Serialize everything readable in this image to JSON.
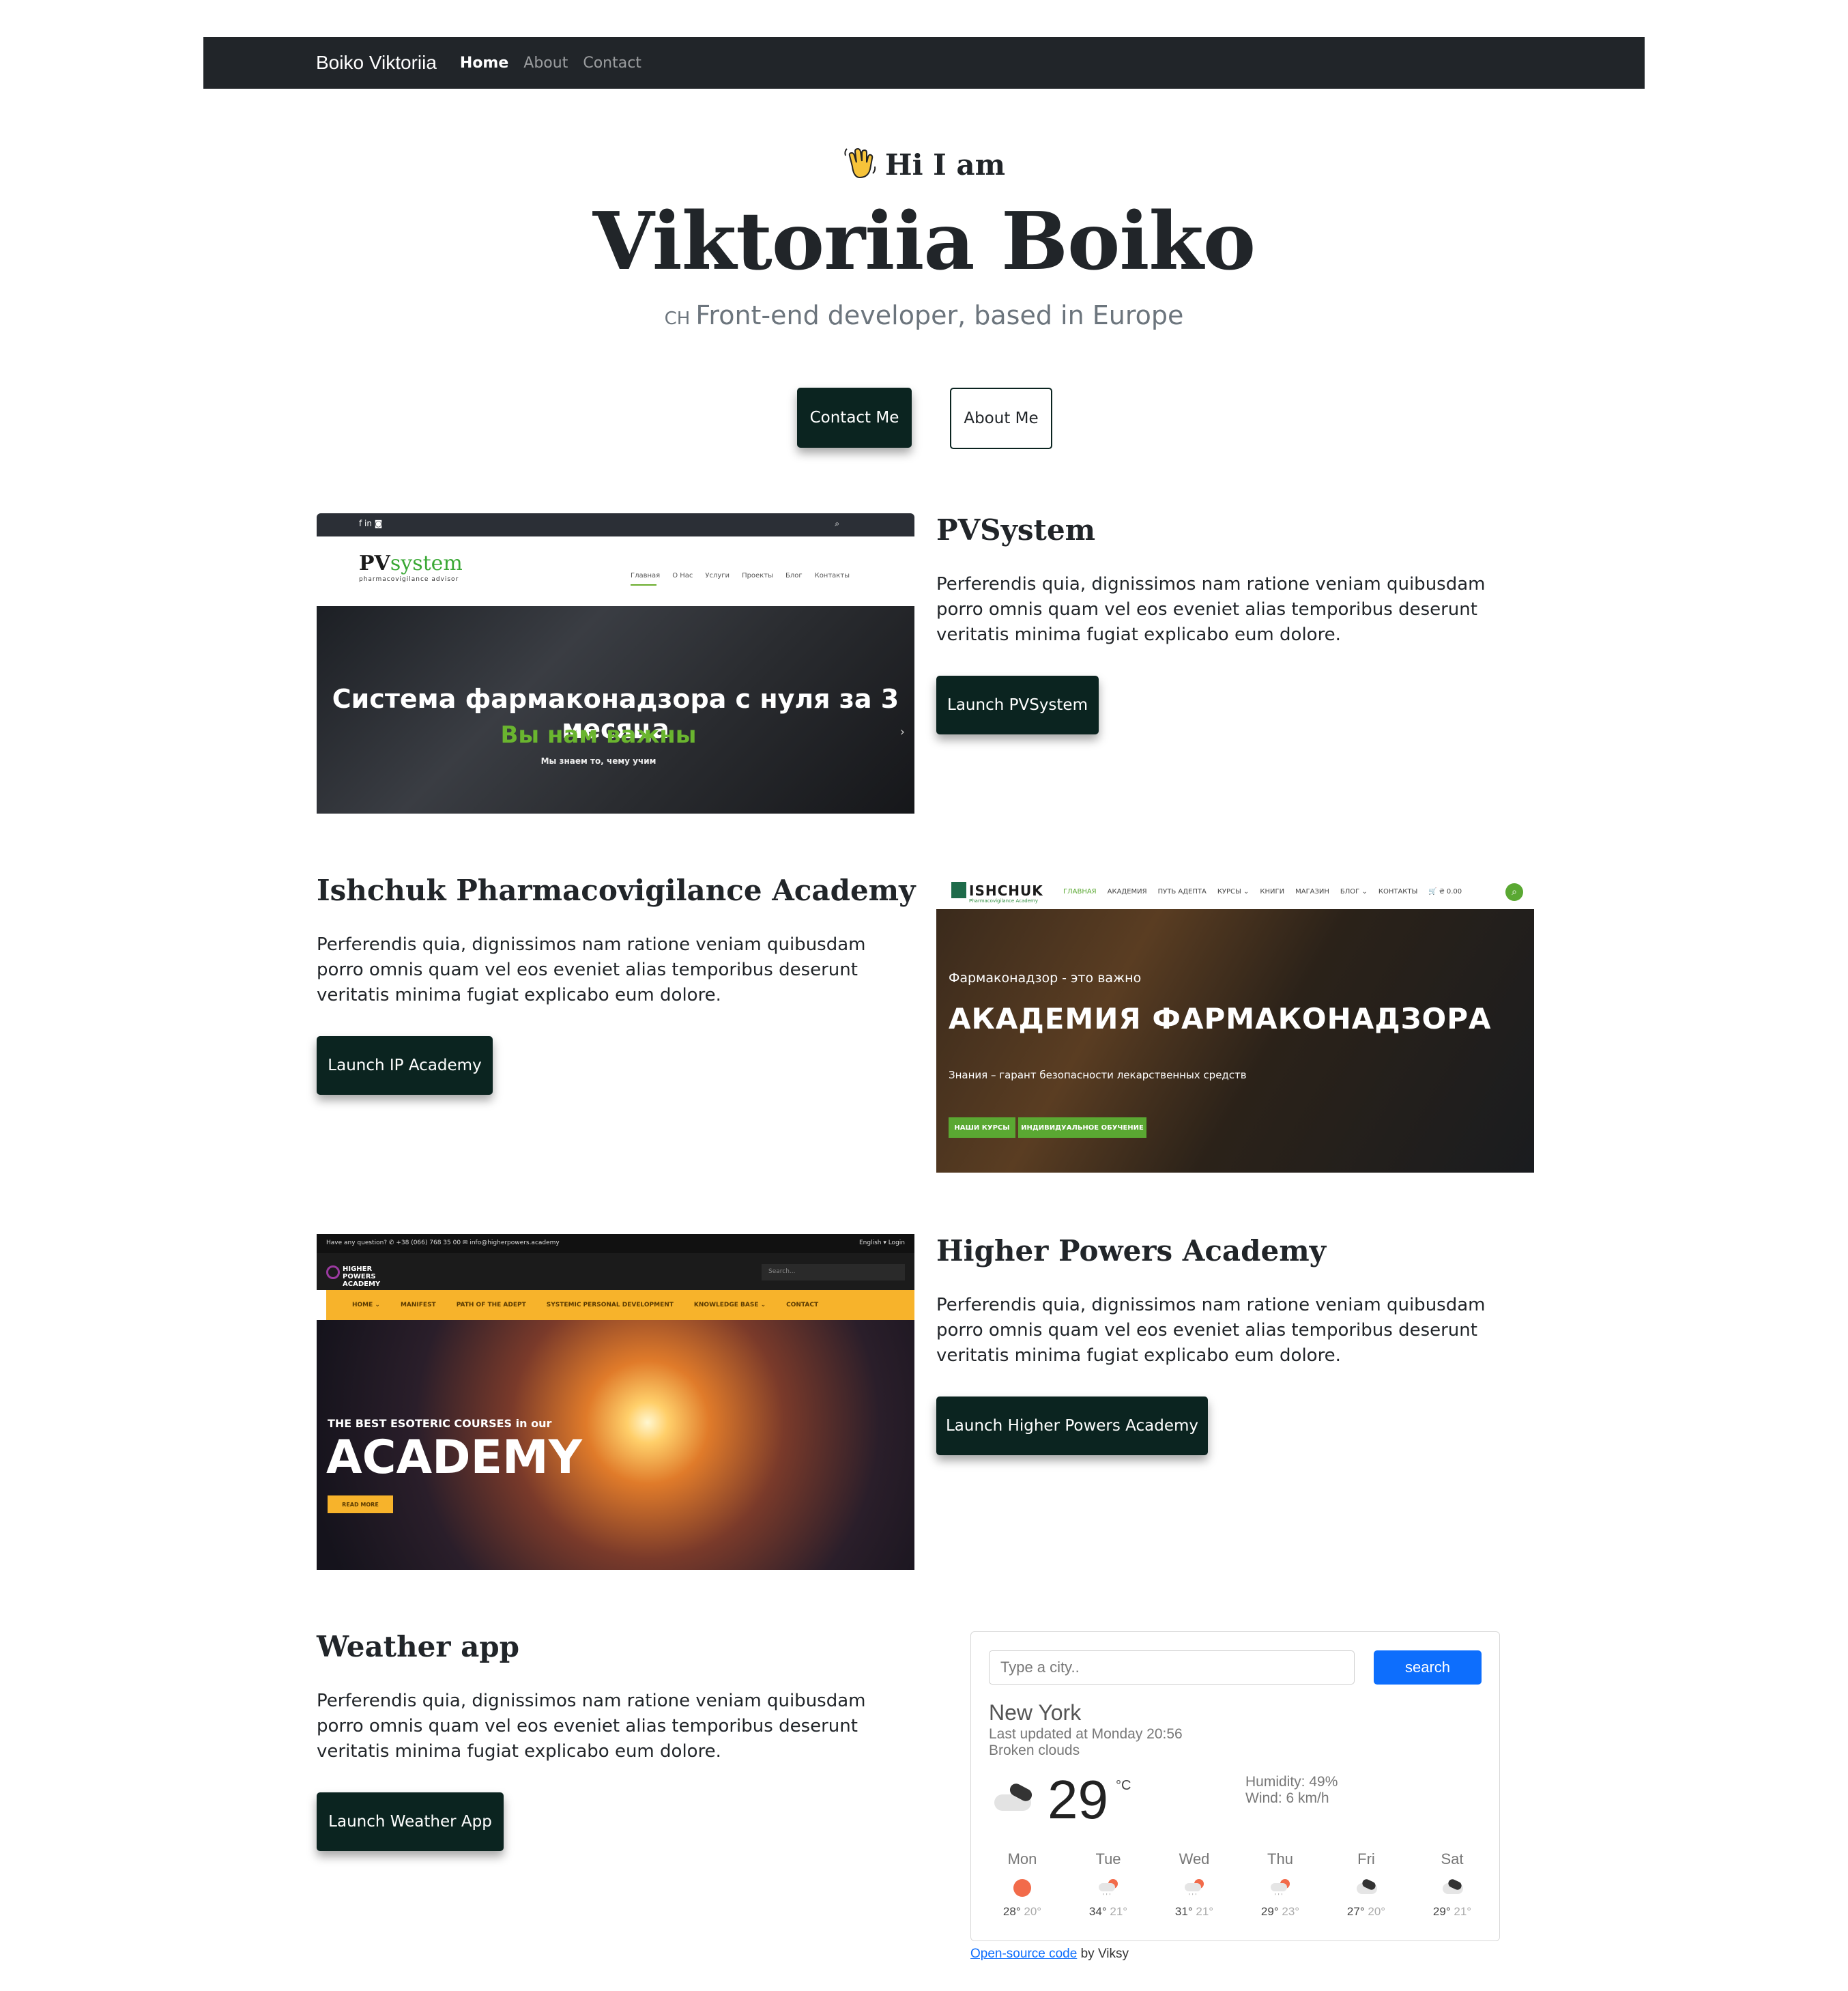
{
  "navbar": {
    "brand": "Boiko Viktoriia",
    "links": [
      "Home",
      "About",
      "Contact"
    ]
  },
  "hero": {
    "greeting": "Hi I am",
    "greeting_icon": "waving-hand-icon",
    "name": "Viktoriia Boiko",
    "subtitle_prefix": "CH",
    "subtitle": "Front-end developer, based in Europe",
    "contact_button": "Contact Me",
    "about_button": "About Me"
  },
  "projects": [
    {
      "title": "PVSystem",
      "description": "Perferendis quia, dignissimos nam ratione veniam quibusdam porro omnis quam vel eos eveniet alias temporibus deserunt veritatis minima fugiat explicabo eum dolore.",
      "button": "Launch PVSystem",
      "screenshot": {
        "logo_a": "PV",
        "logo_b": "system",
        "logo_sub": "pharmacovigilance advisor",
        "social": "f in ◙",
        "menu": [
          "Главная",
          "О Нас",
          "Услуги",
          "Проекты",
          "Блог",
          "Контакты"
        ],
        "headline": "Система фармаконадзора с нуля за 3 месяца",
        "green_line": "Вы нам важны",
        "small_line": "Мы знаем то, чему учим"
      }
    },
    {
      "title": "Ishchuk Pharmacovigilance Academy",
      "description": "Perferendis quia, dignissimos nam ratione veniam quibusdam porro omnis quam vel eos eveniet alias temporibus deserunt veritatis minima fugiat explicabo eum dolore.",
      "button": "Launch IP Academy",
      "screenshot": {
        "logo": "ISHCHUK",
        "logo_sub": "Pharmacovigilance Academy",
        "menu": [
          "ГЛАВНАЯ",
          "АКАДЕМИЯ",
          "ПУТЬ АДЕПТА",
          "КУРСЫ ⌄",
          "КНИГИ",
          "МАГАЗИН",
          "БЛОГ ⌄",
          "КОНТАКТЫ",
          "🛒 ₴ 0.00"
        ],
        "line1": "Фармаконадзор - это важно",
        "line2": "АКАДЕМИЯ ФАРМАКОНАДЗОРА",
        "line3": "Знания – гарант безопасности лекарственных средств",
        "btn1": "НАШИ КУРСЫ",
        "btn2": "ИНДИВИДУАЛЬНОЕ ОБУЧЕНИЕ"
      }
    },
    {
      "title": "Higher Powers Academy",
      "description": "Perferendis quia, dignissimos nam ratione veniam quibusdam porro omnis quam vel eos eveniet alias temporibus deserunt veritatis minima fugiat explicabo eum dolore.",
      "button": "Launch Higher Powers Academy",
      "screenshot": {
        "topbar_left": "Have any question?   ✆ +38 (066) 768 35 00   ✉ info@higherpowers.academy",
        "topbar_right": "English   ▾ Login",
        "logo": "HIGHER POWERS ACADEMY",
        "search": "Search...",
        "menu": [
          "HOME ⌄",
          "MANIFEST",
          "PATH OF THE ADEPT",
          "SYSTEMIC PERSONAL DEVELOPMENT",
          "KNOWLEDGE BASE ⌄",
          "CONTACT"
        ],
        "line1": "THE BEST ESOTERIC COURSES in our",
        "line2": "ACADEMY",
        "btn": "READ MORE"
      }
    },
    {
      "title": "Weather app",
      "description": "Perferendis quia, dignissimos nam ratione veniam quibusdam porro omnis quam vel eos eveniet alias temporibus deserunt veritatis minima fugiat explicabo eum dolore.",
      "button": "Launch Weather App"
    }
  ],
  "weather": {
    "placeholder": "Type a city..",
    "search": "search",
    "city": "New York",
    "updated": "Last updated at Monday 20:56",
    "description": "Broken clouds",
    "temperature": "29",
    "unit": "°C",
    "humidity": "Humidity: 49%",
    "wind": "Wind: 6 km/h",
    "forecast": [
      {
        "day": "Mon",
        "hi": "28°",
        "lo": "20°",
        "icon": "sun-icon"
      },
      {
        "day": "Tue",
        "hi": "34°",
        "lo": "21°",
        "icon": "rain-sun-icon"
      },
      {
        "day": "Wed",
        "hi": "31°",
        "lo": "21°",
        "icon": "rain-sun-icon"
      },
      {
        "day": "Thu",
        "hi": "29°",
        "lo": "23°",
        "icon": "rain-sun-icon"
      },
      {
        "day": "Fri",
        "hi": "27°",
        "lo": "20°",
        "icon": "broken-clouds-icon"
      },
      {
        "day": "Sat",
        "hi": "29°",
        "lo": "21°",
        "icon": "broken-clouds-icon"
      }
    ],
    "footer_link": "Open-source code",
    "footer_text": "by Viksy"
  },
  "colors": {
    "navbar": "#212529",
    "button_dark": "#0b2420",
    "accent_green": "#5aa832",
    "search_blue": "#0d6efd"
  }
}
